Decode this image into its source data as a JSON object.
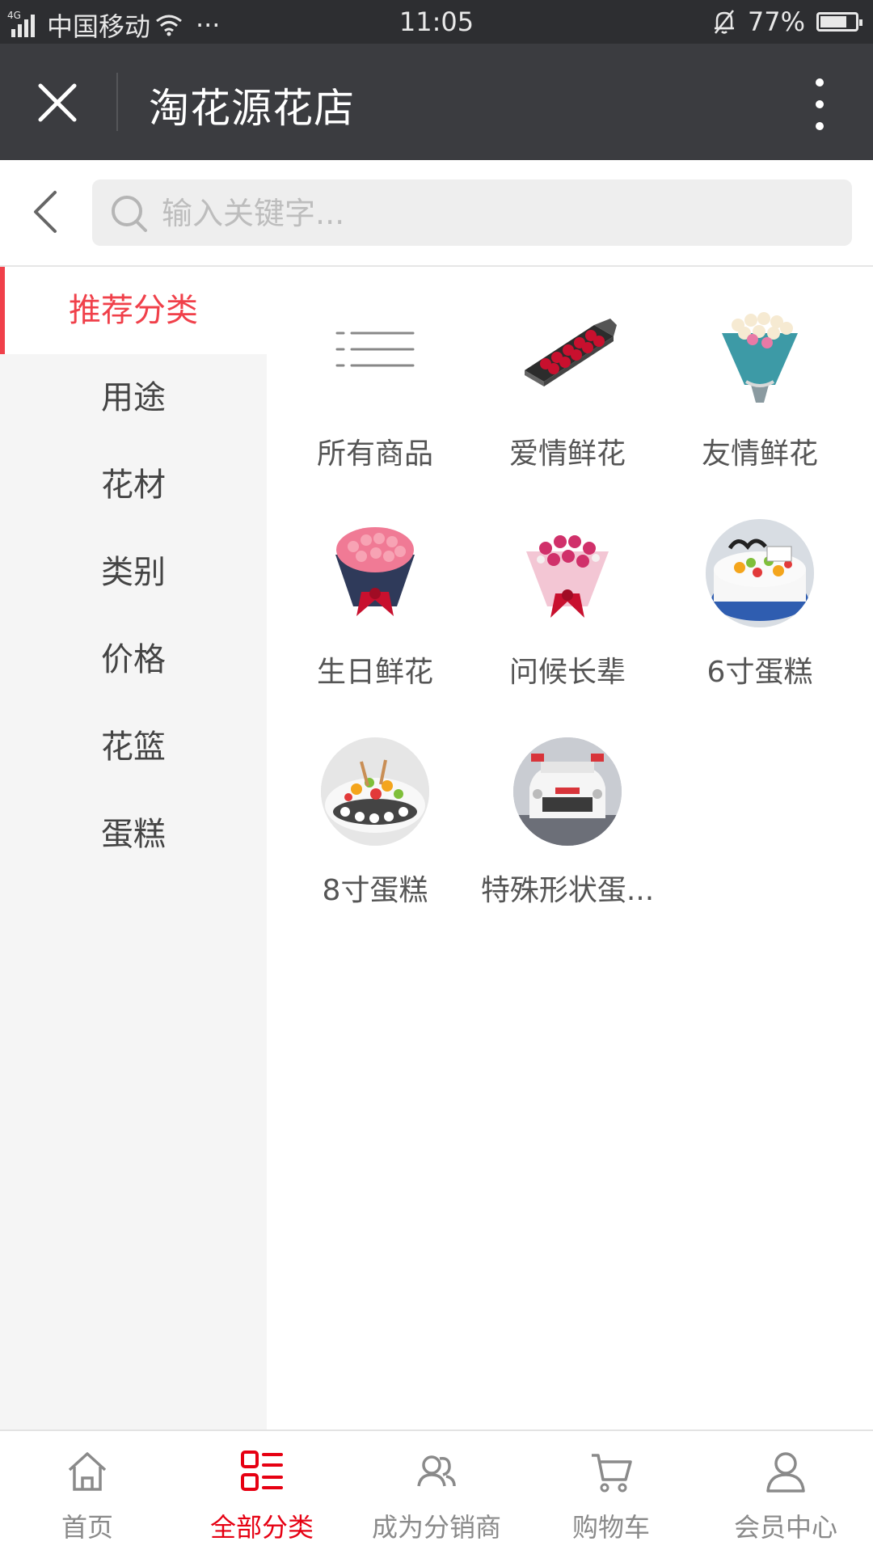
{
  "status_bar": {
    "network": "4G",
    "carrier": "中国移动",
    "extra": "···",
    "time": "11:05",
    "battery": "77%",
    "battery_level": 0.77
  },
  "title_bar": {
    "title": "淘花源花店",
    "close_icon": "close-icon",
    "more_icon": "more-vertical-icon"
  },
  "search": {
    "placeholder": "输入关键字...",
    "value": ""
  },
  "sidebar": {
    "items": [
      {
        "label": "推荐分类",
        "active": true
      },
      {
        "label": "用途"
      },
      {
        "label": "花材"
      },
      {
        "label": "类别"
      },
      {
        "label": "价格"
      },
      {
        "label": "花篮"
      },
      {
        "label": "蛋糕"
      }
    ]
  },
  "categories": [
    {
      "label": "所有商品",
      "icon": "list-icon"
    },
    {
      "label": "爱情鲜花",
      "icon": "rose-box-image"
    },
    {
      "label": "友情鲜花",
      "icon": "lily-bouquet-image"
    },
    {
      "label": "生日鲜花",
      "icon": "pink-rose-bouquet-image"
    },
    {
      "label": "问候长辈",
      "icon": "carnation-bouquet-image"
    },
    {
      "label": "6寸蛋糕",
      "icon": "fruit-cake-image"
    },
    {
      "label": "8寸蛋糕",
      "icon": "fruit-cake-image"
    },
    {
      "label": "特殊形状蛋...",
      "icon": "car-cake-image"
    }
  ],
  "tabbar": {
    "tabs": [
      {
        "label": "首页",
        "icon": "home-icon"
      },
      {
        "label": "全部分类",
        "icon": "category-icon",
        "active": true
      },
      {
        "label": "成为分销商",
        "icon": "users-icon"
      },
      {
        "label": "购物车",
        "icon": "cart-icon"
      },
      {
        "label": "会员中心",
        "icon": "user-icon"
      }
    ]
  },
  "colors": {
    "accent": "#e60012",
    "sidebar_active": "#f0404a",
    "titlebar_bg": "#3b3c40",
    "statusbar_bg": "#2d2e31"
  }
}
